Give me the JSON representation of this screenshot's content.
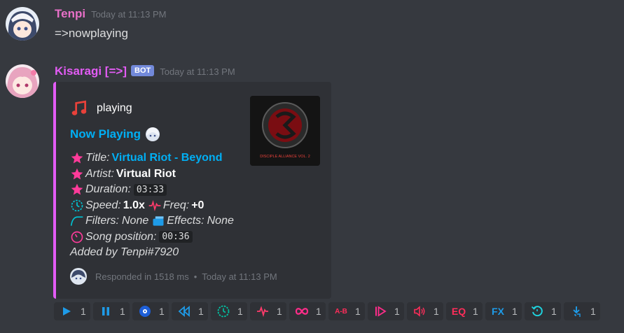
{
  "colors": {
    "bg": "#36393f",
    "embed_bg": "#2f3136",
    "embed_accent": "#e35cf5",
    "link": "#00aff4",
    "pink": "#ff3b9a"
  },
  "messages": [
    {
      "author": "Tenpi",
      "author_color": "#e870c8",
      "timestamp": "Today at 11:13 PM",
      "text": "=>nowplaying"
    },
    {
      "author": "Kisaragi [=>]",
      "author_color": "#e35cf5",
      "badge": "BOT",
      "timestamp": "Today at 11:13 PM"
    }
  ],
  "embed": {
    "author": "playing",
    "title": "Now Playing",
    "fields": {
      "title_label": "Title:",
      "title_value": "Virtual Riot - Beyond",
      "artist_label": "Artist:",
      "artist_value": "Virtual Riot",
      "duration_label": "Duration:",
      "duration_value": "03:33",
      "speed_label": "Speed:",
      "speed_value": "1.0x",
      "freq_label": "Freq:",
      "freq_value": "+0",
      "filters_label": "Filters:",
      "filters_value": "None",
      "effects_label": "Effects:",
      "effects_value": "None",
      "position_label": "Song position:",
      "position_value": "00:36",
      "added_by": "Added by Tenpi#7920"
    },
    "thumbnail_text": "DISCIPLE ALLIANCE VOL. 2",
    "footer": {
      "text": "Responded in 1518 ms",
      "timestamp": "Today at 11:13 PM"
    }
  },
  "reactions": [
    {
      "icon": "play-icon",
      "count": "1"
    },
    {
      "icon": "pause-icon",
      "count": "1"
    },
    {
      "icon": "disc-icon",
      "count": "1"
    },
    {
      "icon": "rewind-icon",
      "count": "1"
    },
    {
      "icon": "clock-icon",
      "count": "1"
    },
    {
      "icon": "pulse-icon",
      "count": "1"
    },
    {
      "icon": "loop-icon",
      "count": "1"
    },
    {
      "icon": "ab-icon",
      "label": "A-B",
      "count": "1"
    },
    {
      "icon": "skip-icon",
      "count": "1"
    },
    {
      "icon": "volume-icon",
      "count": "1"
    },
    {
      "icon": "eq-icon",
      "label": "EQ",
      "count": "1"
    },
    {
      "icon": "fx-icon",
      "label": "FX",
      "count": "1"
    },
    {
      "icon": "reset-icon",
      "count": "1"
    },
    {
      "icon": "download-icon",
      "count": "1"
    }
  ]
}
